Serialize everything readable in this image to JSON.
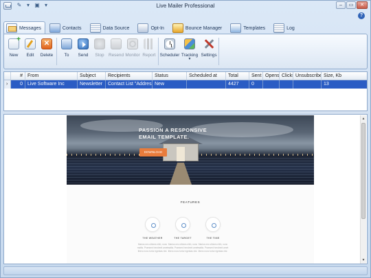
{
  "window": {
    "title": "Live Mailer Professional"
  },
  "tabs": [
    {
      "label": "Messages",
      "icon": "mail-icon"
    },
    {
      "label": "Contacts",
      "icon": "contacts-icon"
    },
    {
      "label": "Data Source",
      "icon": "database-icon"
    },
    {
      "label": "Opt-In",
      "icon": "opt-in-icon"
    },
    {
      "label": "Bounce Manager",
      "icon": "bounce-icon"
    },
    {
      "label": "Templates",
      "icon": "templates-icon"
    },
    {
      "label": "Log",
      "icon": "log-icon"
    }
  ],
  "ribbon": {
    "new": "New",
    "edit": "Edit",
    "delete": "Delete",
    "to": "To",
    "send": "Send",
    "stop": "Stop",
    "resend": "Resend",
    "monitor": "Monitor",
    "report": "Report",
    "scheduler": "Scheduler",
    "tracking": "Tracking",
    "settings": "Settings"
  },
  "grid": {
    "headers": [
      "#",
      "From",
      "Subject",
      "Recipients",
      "Status",
      "Scheduled at",
      "Total",
      "Sent",
      "Opens",
      "Clicks",
      "Unsubscribes",
      "Size, Kb"
    ],
    "rows": [
      {
        "num": "0",
        "from": "Live Software Inc",
        "subject": "Newsletter",
        "recipients": "Contact List \"Addresses\"",
        "status": "New",
        "scheduled": "",
        "total": "4427",
        "sent": "0",
        "opens": "",
        "clicks": "",
        "unsubscribes": "",
        "size": "13"
      }
    ]
  },
  "preview": {
    "hero_title": "PASSION A RESPONSIVE EMAIL TEMPLATE.",
    "hero_button": "DOWNLOAD",
    "features_title": "FEATURES",
    "features": [
      {
        "name": "THE WEATHER",
        "desc": "Marius nec ultrices nibh, nunc mattis. Praesent hendrerit amet libero nunc tortor egestas nisl."
      },
      {
        "name": "THE TARGET",
        "desc": "Marius nec ultrices nibh, nunc mattis. Praesent hendrerit amet libero nunc tortor egestas nisl."
      },
      {
        "name": "THE TIME",
        "desc": "Marius nec ultrices nibh, nunc mattis. Praesent hendrerit amet libero nunc tortor egestas nisl."
      }
    ]
  },
  "colors": {
    "accent": "#2a5cc4",
    "chrome": "#c7d9ee",
    "hero_button": "#e97c3c"
  }
}
